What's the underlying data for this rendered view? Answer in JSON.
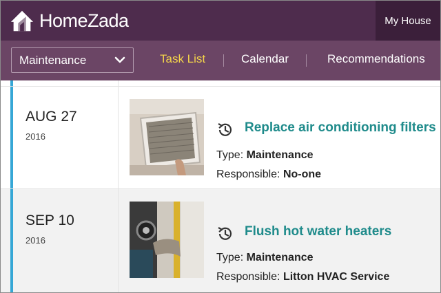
{
  "header": {
    "brand": "HomeZada",
    "house_button": "My House"
  },
  "nav": {
    "select_value": "Maintenance",
    "tabs": [
      {
        "label": "Task List",
        "active": true
      },
      {
        "label": "Calendar",
        "active": false
      },
      {
        "label": "Recommendations",
        "active": false
      }
    ]
  },
  "colors": {
    "header": "#4e2c4d",
    "nav": "#6b4565",
    "accent": "#f3d34a",
    "link": "#1f8b8b",
    "marker": "#36a7d6"
  },
  "tasks": [
    {
      "month_day": "AUG 27",
      "year": "2016",
      "title": "Replace air conditioning filters",
      "type_label": "Type:",
      "type_value": "Maintenance",
      "resp_label": "Responsible:",
      "resp_value": "No-one",
      "icon": "history-icon"
    },
    {
      "month_day": "SEP 10",
      "year": "2016",
      "title": "Flush hot water heaters",
      "type_label": "Type:",
      "type_value": "Maintenance",
      "resp_label": "Responsible:",
      "resp_value": "Litton HVAC Service",
      "icon": "history-icon"
    }
  ]
}
